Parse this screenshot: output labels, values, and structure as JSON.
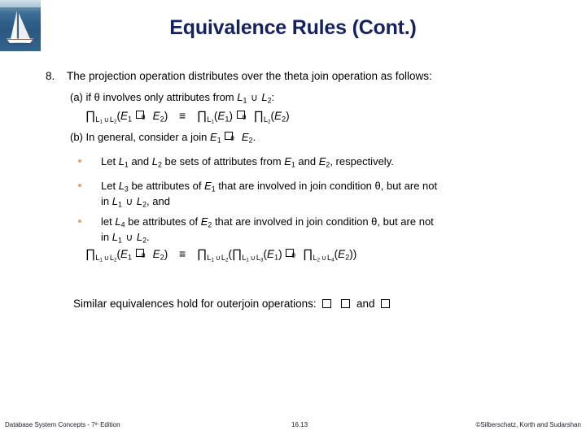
{
  "slide": {
    "title": "Equivalence Rules (Cont.)",
    "title_color": "#16225e",
    "background": "#ffffff",
    "decoration": {
      "image_name": "sailboat-photo"
    }
  },
  "content": {
    "item_number": "8.",
    "item_text": "The projection operation distributes over the theta join operation as follows:",
    "sub_a_label": "(a)",
    "sub_a_text_pre": "if",
    "sub_a_theta": "θ",
    "sub_a_text_post": "involves only attributes from",
    "sub_a_L1": "L",
    "sub_a_L1_sub": "1",
    "sub_a_union": "∪",
    "sub_a_L2": "L",
    "sub_a_L2_sub": "2",
    "sub_a_colon": ":",
    "sub_b_label": "(b)",
    "sub_b_text": "In general, consider a join",
    "sub_b_E1": "E",
    "sub_b_E1_sub": "1",
    "sub_b_E2": "E",
    "sub_b_E2_sub": "2",
    "sub_b_period": ".",
    "bullets": [
      {
        "marker_color": "#e8a26a",
        "text": "Let L1 and L2 be sets of attributes from E1 and E2, respectively."
      },
      {
        "marker_color": "#e8a26a",
        "text": "Let L3 be attributes of E1 that are involved in join condition θ, but are not in L1 ∪ L2, and"
      },
      {
        "marker_color": "#e8a26a",
        "text": "let L4 be attributes of E2 that are involved in join condition θ, but are not in L1 ∪ L2."
      }
    ],
    "similar_text": "Similar equivalences hold for outerjoin operations:",
    "similar_and": "and",
    "symbols": {
      "pi": "∏",
      "union": "∪",
      "equivalent": "≡",
      "theta": "θ",
      "join_glyph_name": "theta-join-bowtie",
      "outerjoin_glyph_name": "missing-glyph-box"
    },
    "formula_a": {
      "lhs": "∏ L1∪L2 ( E1 ⋈θ E2 )",
      "rel": "≡",
      "rhs": "∏ L1 ( E1 ) ⋈θ ∏ L2 ( E2 )"
    },
    "formula_big": {
      "lhs": "∏ L1∪L2 ( E1 ⋈θ E2 )",
      "rel": "≡",
      "rhs": "∏ L1∪L2 ( ∏ L1∪L3 ( E1 ) ⋈θ ∏ L2∪L4 ( E2 ) )"
    }
  },
  "footer": {
    "left_pre": "Database System Concepts - 7",
    "left_sup": "th",
    "left_post": " Edition",
    "page": "16.13",
    "right": "©Silberschatz, Korth and Sudarshan"
  }
}
